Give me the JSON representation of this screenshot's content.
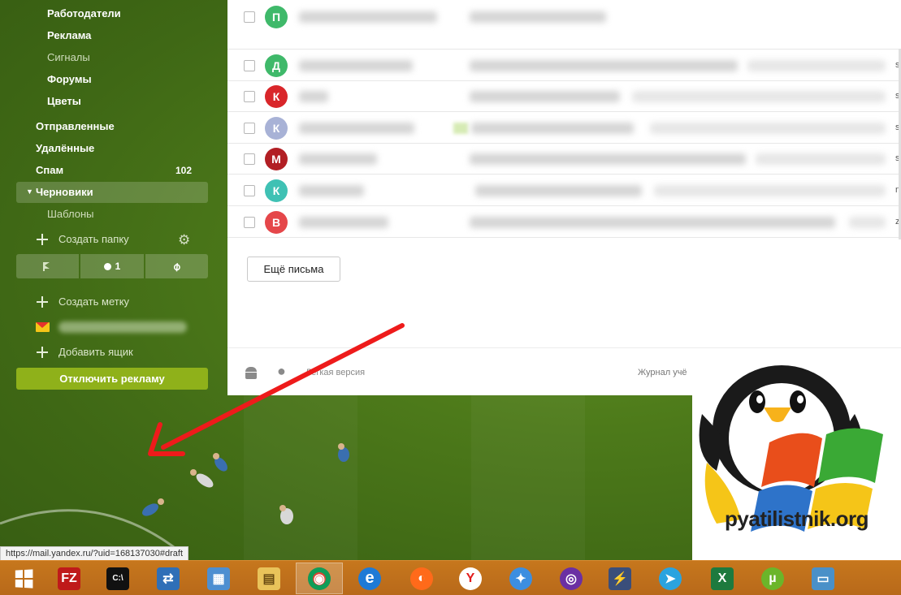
{
  "sidebar": {
    "folders": [
      {
        "label": "Работодатели"
      },
      {
        "label": "Реклама"
      },
      {
        "label": "Сигналы"
      },
      {
        "label": "Форумы"
      },
      {
        "label": "Цветы"
      },
      {
        "label": "Отправленные"
      },
      {
        "label": "Удалённые"
      },
      {
        "label": "Спам",
        "count": "102"
      },
      {
        "label": "Черновики"
      },
      {
        "label": "Шаблоны"
      }
    ],
    "create_folder": "Создать папку",
    "tools": {
      "unread_count": "1"
    },
    "create_label": "Создать метку",
    "add_mailbox": "Добавить ящик",
    "disable_ads": "Отключить рекламу"
  },
  "mail": {
    "avatars": [
      {
        "letter": "П",
        "color": "#3fb96a"
      },
      {
        "letter": "Д",
        "color": "#3fb96a"
      },
      {
        "letter": "К",
        "color": "#d9262a"
      },
      {
        "letter": "К",
        "color": "#a8b2d6"
      },
      {
        "letter": "М",
        "color": "#b21f24"
      },
      {
        "letter": "К",
        "color": "#3fc1b4"
      },
      {
        "letter": "В",
        "color": "#e5474a"
      }
    ],
    "edge_chars": [
      "s",
      "s",
      "s",
      "s",
      "n",
      "z"
    ],
    "more_button": "Ещё письма",
    "footer": {
      "light_version": "Лёгкая версия",
      "journal": "Журнал учё"
    }
  },
  "overlay": {
    "site": "pyatilistnik.org",
    "status_url": "https://mail.yandex.ru/?uid=168137030#draft"
  },
  "taskbar": {
    "apps": [
      {
        "icon": "start-icon",
        "symbol": ""
      },
      {
        "icon": "filezilla-icon",
        "symbol": "FZ"
      },
      {
        "icon": "cmd-icon",
        "symbol": "C:\\"
      },
      {
        "icon": "network-icon",
        "symbol": "⇄"
      },
      {
        "icon": "remote-desktop-icon",
        "symbol": "▦"
      },
      {
        "icon": "explorer-icon",
        "symbol": "▤"
      },
      {
        "icon": "chrome-icon",
        "symbol": "◉"
      },
      {
        "icon": "ie-icon",
        "symbol": "e"
      },
      {
        "icon": "firefox-icon",
        "symbol": "◐"
      },
      {
        "icon": "yandex-browser-icon",
        "symbol": "Y"
      },
      {
        "icon": "safari-icon",
        "symbol": "✦"
      },
      {
        "icon": "tor-icon",
        "symbol": "◎"
      },
      {
        "icon": "putty-icon",
        "symbol": "⚡"
      },
      {
        "icon": "telegram-icon",
        "symbol": "➤"
      },
      {
        "icon": "excel-icon",
        "symbol": "X"
      },
      {
        "icon": "utorrent-icon",
        "symbol": "µ"
      },
      {
        "icon": "photos-icon",
        "symbol": "▭"
      }
    ]
  }
}
